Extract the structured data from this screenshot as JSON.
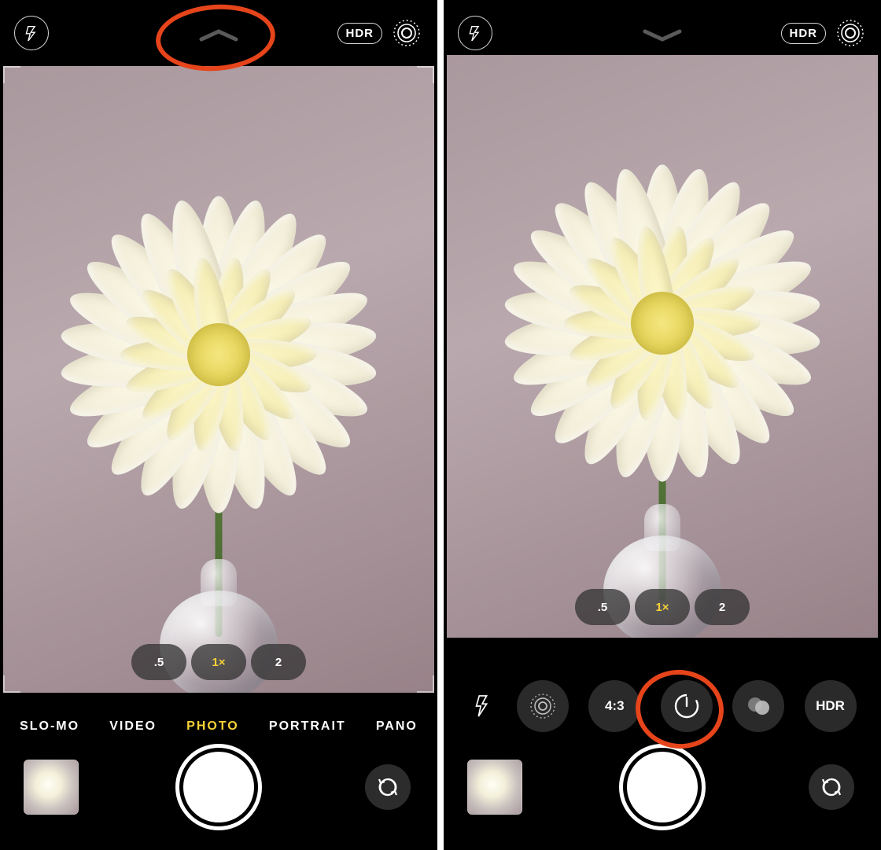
{
  "left": {
    "top": {
      "hdr_label": "HDR"
    },
    "zoom": {
      "wide": ".5",
      "main": "1×",
      "tele": "2"
    },
    "modes": [
      "SLO-MO",
      "VIDEO",
      "PHOTO",
      "PORTRAIT",
      "PANO"
    ],
    "active_mode_index": 2
  },
  "right": {
    "top": {
      "hdr_label": "HDR"
    },
    "zoom": {
      "wide": ".5",
      "main": "1×",
      "tele": "2"
    },
    "tools": {
      "aspect_label": "4:3",
      "hdr_label": "HDR"
    }
  },
  "annotations": {
    "left_circle": "chevron-up highlighted",
    "right_circle": "timer tool highlighted"
  }
}
